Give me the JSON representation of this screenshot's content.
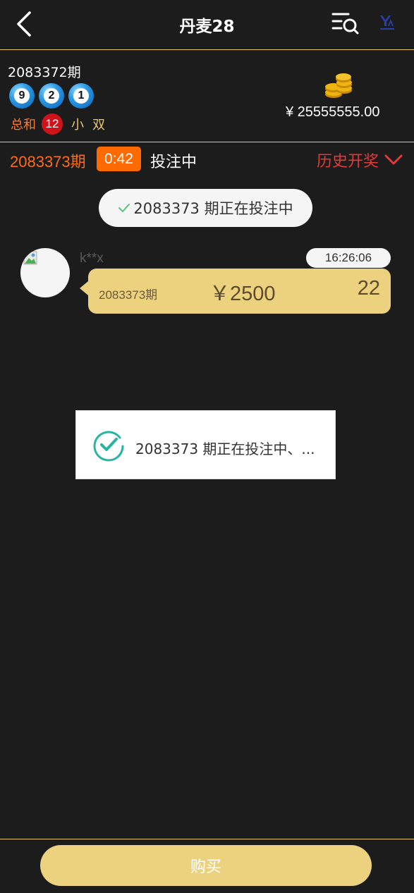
{
  "header": {
    "title": "丹麦28",
    "back_icon": "chevron-left-icon",
    "search_icon": "list-search-icon",
    "logo_icon": "brand-logo-icon"
  },
  "last_draw": {
    "period": "2083372期",
    "balls": [
      "9",
      "2",
      "1"
    ],
    "sum_label": "总和",
    "sum_value": "12",
    "size": "小",
    "parity": "双"
  },
  "account": {
    "balance": "¥ 25555555.00",
    "coins_icon": "coins-icon"
  },
  "current": {
    "period": "2083373期",
    "countdown": "0:42",
    "status": "投注中",
    "history_label": "历史开奖"
  },
  "status_pill": {
    "text": "2083373 期正在投注中"
  },
  "message": {
    "username": "k**x",
    "time": "16:26:06",
    "period": "2083373期",
    "amount": "￥2500",
    "pick": "22"
  },
  "toast": {
    "text": "2083373 期正在投注中、..."
  },
  "footer": {
    "buy_label": "购买"
  },
  "colors": {
    "background": "#1c1c1c",
    "accent_gold": "#ecd27e",
    "accent_orange": "#ff6a00",
    "accent_red": "#e03a3a",
    "success_teal": "#26b4a4"
  }
}
